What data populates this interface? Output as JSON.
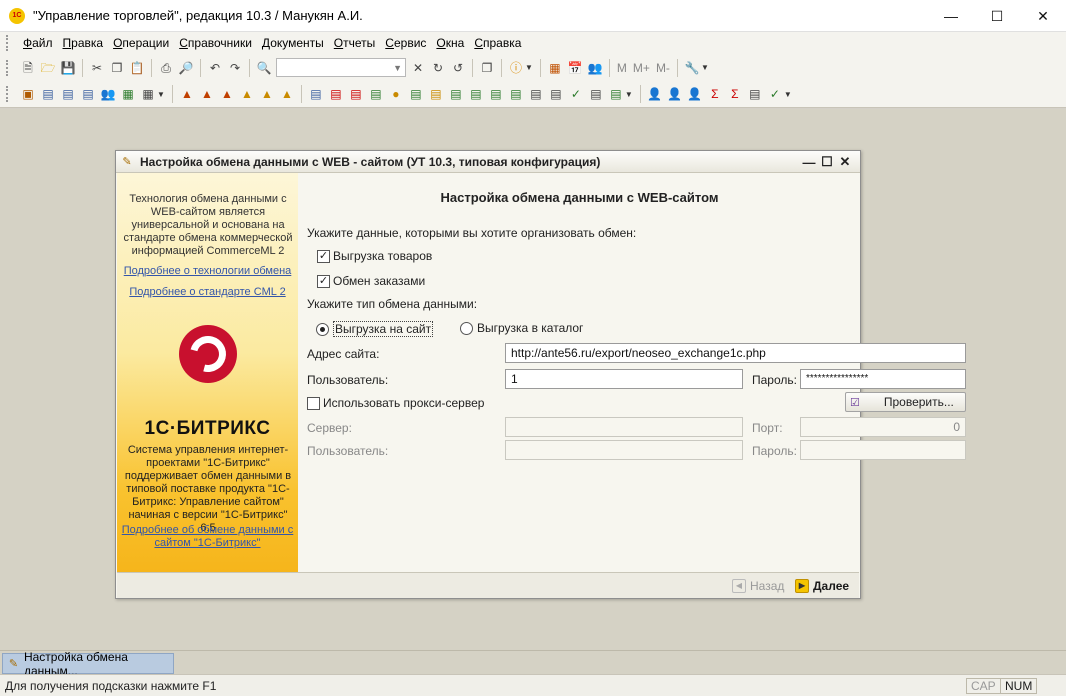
{
  "window": {
    "title": "\"Управление торговлей\", редакция 10.3 / Манукян А.И.",
    "app_icon": "1c-logo-icon",
    "controls": [
      "minimize-icon",
      "maximize-icon",
      "close-icon"
    ]
  },
  "menu": [
    "Файл",
    "Правка",
    "Операции",
    "Справочники",
    "Документы",
    "Отчеты",
    "Сервис",
    "Окна",
    "Справка"
  ],
  "toolbar1": {
    "memory_buttons": [
      "M",
      "M+",
      "M-"
    ]
  },
  "dialog": {
    "title": "Настройка обмена данными с WEB - сайтом (УТ 10.3, типовая конфигурация)",
    "sidebar": {
      "intro": "Технология обмена данными с WEB-сайтом является универсальной и основана на стандарте обмена коммерческой информацией CommerceML 2",
      "link_technology": "Подробнее о технологии обмена",
      "link_standard": "Подробнее о стандарте CML 2",
      "logo_text": "1С·БИТРИКС",
      "bitrix_text": "Система управления интернет-проектами \"1С-Битрикс\" поддерживает обмен данными в типовой поставке продукта \"1С-Битрикс: Управление сайтом\" начиная с версии \"1С-Битрикс\" 6.5",
      "link_bitrix": "Подробнее об обмене данными с сайтом \"1С-Битрикс\""
    },
    "heading": "Настройка обмена данными с WEB-сайтом",
    "prompt_data": "Укажите данные, которыми вы хотите организовать обмен:",
    "check_goods": "Выгрузка товаров",
    "check_orders": "Обмен заказами",
    "prompt_type": "Укажите тип обмена данными:",
    "radio_site": "Выгрузка на сайт",
    "radio_catalog": "Выгрузка в каталог",
    "address_label": "Адрес сайта:",
    "address_value": "http://ante56.ru/export/neoseo_exchange1c.php",
    "user_label": "Пользователь:",
    "user_value": "1",
    "password_label": "Пароль:",
    "password_value": "****************",
    "proxy_label": "Использовать прокси-сервер",
    "check_button": "Проверить...",
    "server_label": "Сервер:",
    "port_label": "Порт:",
    "port_value": "0",
    "proxy_user_label": "Пользователь:",
    "proxy_password_label": "Пароль:",
    "back_button": "Назад",
    "next_button": "Далее"
  },
  "taskbar": {
    "item": "Настройка обмена данным..."
  },
  "statusbar": {
    "hint": "Для получения подсказки нажмите F1",
    "cap": "CAP",
    "num": "NUM"
  }
}
